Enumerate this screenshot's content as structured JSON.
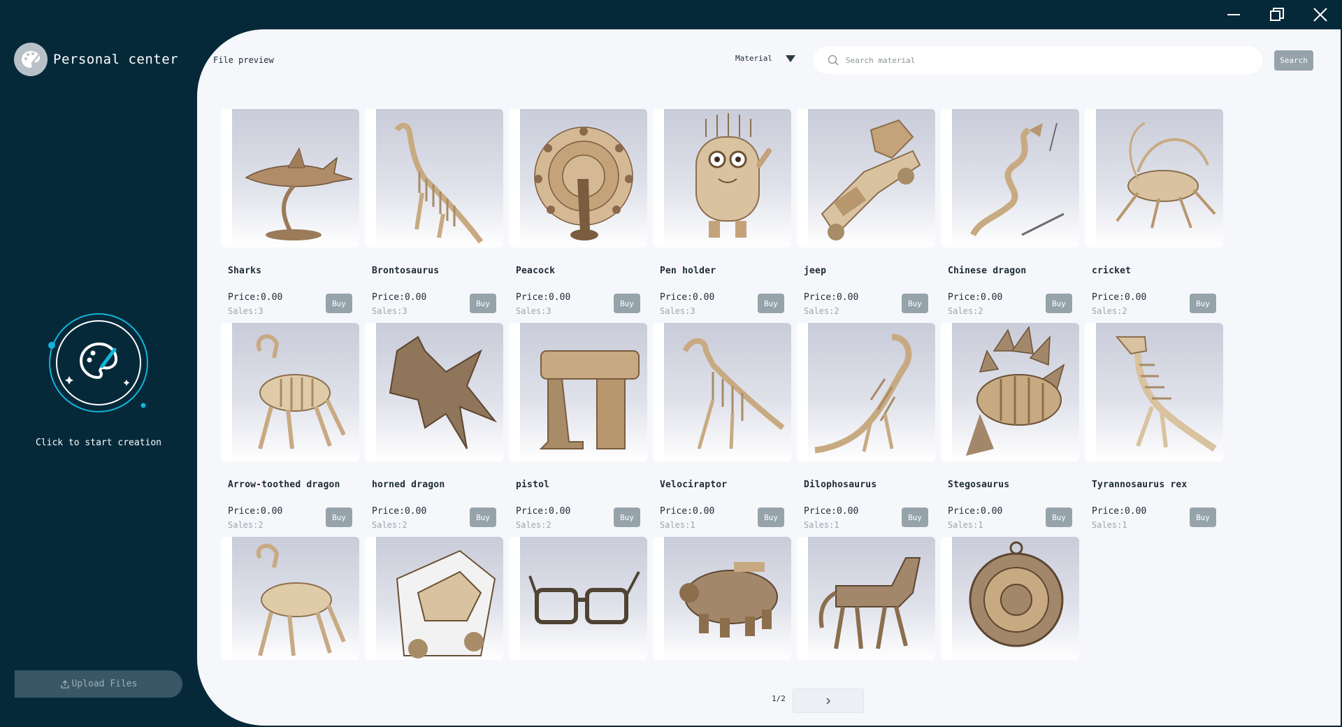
{
  "sidebar": {
    "profile_name": "Personal center",
    "create_label": "Click to start creation",
    "upload_label": "Upload Files"
  },
  "header": {
    "breadcrumb": "File preview",
    "material_label": "Material",
    "search_placeholder": "Search material",
    "search_button": "Search"
  },
  "products": [
    {
      "name": "Sharks",
      "price": "Price:0.00",
      "sales": "Sales:3",
      "buy": "Buy"
    },
    {
      "name": "Brontosaurus",
      "price": "Price:0.00",
      "sales": "Sales:3",
      "buy": "Buy"
    },
    {
      "name": "Peacock",
      "price": "Price:0.00",
      "sales": "Sales:3",
      "buy": "Buy"
    },
    {
      "name": "Pen holder",
      "price": "Price:0.00",
      "sales": "Sales:3",
      "buy": "Buy"
    },
    {
      "name": "jeep",
      "price": "Price:0.00",
      "sales": "Sales:2",
      "buy": "Buy"
    },
    {
      "name": "Chinese dragon",
      "price": "Price:0.00",
      "sales": "Sales:2",
      "buy": "Buy"
    },
    {
      "name": "cricket",
      "price": "Price:0.00",
      "sales": "Sales:2",
      "buy": "Buy"
    },
    {
      "name": "Arrow-toothed dragon",
      "price": "Price:0.00",
      "sales": "Sales:2",
      "buy": "Buy"
    },
    {
      "name": "horned dragon",
      "price": "Price:0.00",
      "sales": "Sales:2",
      "buy": "Buy"
    },
    {
      "name": "pistol",
      "price": "Price:0.00",
      "sales": "Sales:2",
      "buy": "Buy"
    },
    {
      "name": "Velociraptor",
      "price": "Price:0.00",
      "sales": "Sales:1",
      "buy": "Buy"
    },
    {
      "name": "Dilophosaurus",
      "price": "Price:0.00",
      "sales": "Sales:1",
      "buy": "Buy"
    },
    {
      "name": "Stegosaurus",
      "price": "Price:0.00",
      "sales": "Sales:1",
      "buy": "Buy"
    },
    {
      "name": "Tyrannosaurus rex",
      "price": "Price:0.00",
      "sales": "Sales:1",
      "buy": "Buy"
    }
  ],
  "pagination": {
    "indicator": "1/2"
  },
  "colors": {
    "sidebar_bg": "#06293a",
    "main_bg": "#f6f7fb",
    "button_grey": "#96a3ab",
    "accent_cyan": "#12b5d8",
    "wood": "#c8aa82"
  }
}
